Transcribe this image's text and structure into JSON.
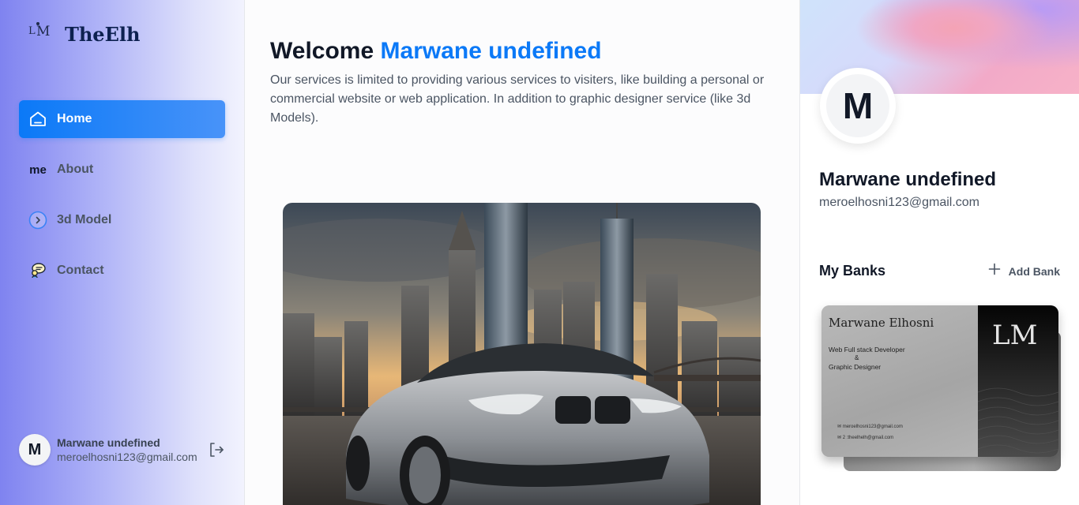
{
  "app": {
    "brand": "TheElh",
    "logo_letters": "LM"
  },
  "sidebar": {
    "items": [
      {
        "label": "Home",
        "icon": "home-icon",
        "active": true
      },
      {
        "label": "About",
        "icon": "me-icon",
        "icon_text": "me",
        "active": false
      },
      {
        "label": "3d Model",
        "icon": "chevron-right-circle-icon",
        "active": false
      },
      {
        "label": "Contact",
        "icon": "contact-icon",
        "active": false
      }
    ],
    "user": {
      "initial": "M",
      "name": "Marwane undefined",
      "email": "meroelhosni123@gmail.com"
    }
  },
  "main": {
    "welcome_prefix": "Welcome",
    "welcome_name": "Marwane undefined",
    "description": "Our services is limited to providing various services to visiters, like building a personal or commercial website or web application. In addition to graphic designer service (like 3d Models)."
  },
  "profile": {
    "initial": "M",
    "name": "Marwane undefined",
    "email": "meroelhosni123@gmail.com",
    "banks_title": "My Banks",
    "add_bank_label": "Add Bank"
  },
  "card": {
    "name": "Marwane  Elhosni",
    "role_line1": "Web Full stack Developer",
    "amp": "&",
    "role_line2": "Graphic Designer",
    "contact1": "meroelhosni123@gmail.com",
    "contact2": "2 :theelhelh@gmail.com",
    "logo": "LM"
  },
  "colors": {
    "accent": "#0b79f7",
    "text_dark": "#111827",
    "text_muted": "#4b5563"
  }
}
